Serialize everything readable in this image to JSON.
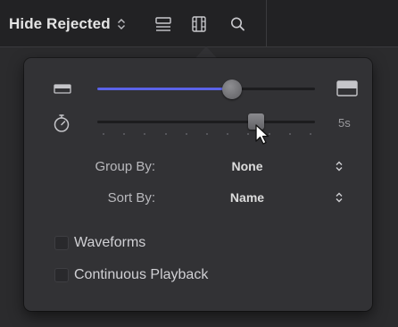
{
  "toolbar": {
    "filter_label": "Hide Rejected",
    "icons": [
      "clip-appearance-icon",
      "filmstrip-icon",
      "search-icon"
    ]
  },
  "popover": {
    "clip_height": {
      "value": 0.62
    },
    "clip_duration": {
      "value": 0.73,
      "label": "5s"
    },
    "group_by": {
      "label": "Group By:",
      "value": "None"
    },
    "sort_by": {
      "label": "Sort By:",
      "value": "Name"
    },
    "waveforms": {
      "label": "Waveforms",
      "checked": false
    },
    "continuous_playback": {
      "label": "Continuous Playback",
      "checked": false
    }
  },
  "colors": {
    "accent": "#5b63e8",
    "popover_bg": "#323235",
    "toolbar_bg": "#222224"
  }
}
